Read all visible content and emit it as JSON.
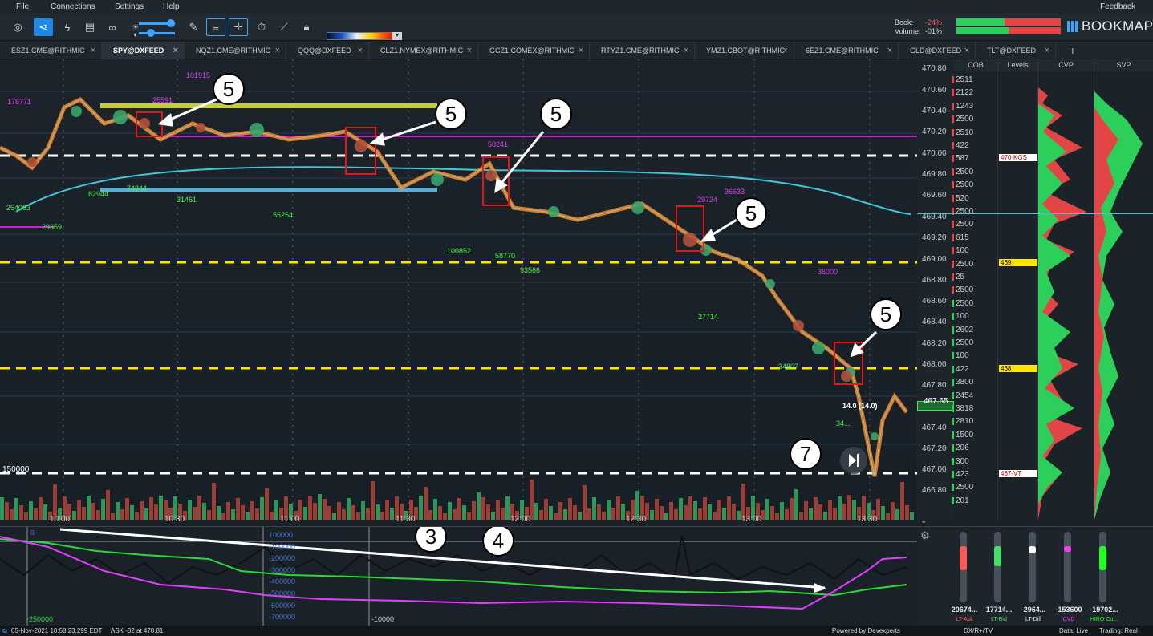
{
  "menu": {
    "items": [
      "File",
      "Connections",
      "Settings",
      "Help"
    ],
    "feedback": "Feedback"
  },
  "toolbar": {
    "book_label": "Book:",
    "book_value": "-24%",
    "volume_label": "Volume:",
    "volume_value": "-01%",
    "logo": "BOOKMAP"
  },
  "tabs": [
    {
      "label": "ESZ1.CME@RITHMIC"
    },
    {
      "label": "SPY@DXFEED",
      "active": true
    },
    {
      "label": "NQZ1.CME@RITHMIC"
    },
    {
      "label": "QQQ@DXFEED"
    },
    {
      "label": "CLZ1.NYMEX@RITHMIC"
    },
    {
      "label": "GCZ1.COMEX@RITHMIC"
    },
    {
      "label": "RTYZ1.CME@RITHMIC"
    },
    {
      "label": "YMZ1.CBOT@RITHMIC"
    },
    {
      "label": "6EZ1.CME@RITHMIC"
    },
    {
      "label": "GLD@DXFEED"
    },
    {
      "label": "TLT@DXFEED"
    }
  ],
  "columns": {
    "cob": "COB",
    "levels": "Levels",
    "cvp": "CVP",
    "svp": "SVP"
  },
  "price_axis": [
    "470.80",
    "470.60",
    "470.40",
    "470.20",
    "470.00",
    "469.80",
    "469.60",
    "469.40",
    "469.20",
    "469.00",
    "468.80",
    "468.60",
    "468.40",
    "468.20",
    "468.00",
    "467.80",
    "467.65",
    "467.40",
    "467.20",
    "467.00",
    "466.80"
  ],
  "cob_values": [
    "2511",
    "2122",
    "1243",
    "2500",
    "2510",
    "422",
    "587",
    "2500",
    "2500",
    "520",
    "2500",
    "2500",
    "615",
    "100",
    "2500",
    "25",
    "2500",
    "2500",
    "100",
    "2602",
    "2500",
    "100",
    "422",
    "3800",
    "2454",
    "3818",
    "2810",
    "1500",
    "206",
    "300",
    "423",
    "2500",
    "201"
  ],
  "level_tags": [
    "470-KGS",
    "469",
    "468",
    "467-VT"
  ],
  "time_labels": [
    "10:00",
    "10:30",
    "11:00",
    "11:30",
    "12:00",
    "12:30",
    "13:00",
    "13:30"
  ],
  "chart_labels": {
    "volume_scale": "150000",
    "level_numbers": [
      "178771",
      "101915",
      "25591",
      "82944",
      "74844",
      "31461",
      "254063",
      "29359",
      "55254",
      "58241",
      "100852",
      "58770",
      "93566",
      "29724",
      "36633",
      "27714",
      "36000",
      "34807",
      "34..."
    ],
    "last_trade": "14.0 (14.0)"
  },
  "annotations": {
    "five": "5",
    "three": "3",
    "four": "4",
    "seven": "7"
  },
  "indicator": {
    "scale": [
      "100000",
      "-100000",
      "-200000",
      "-300000",
      "-400000",
      "-500000",
      "-600000",
      "-700000"
    ],
    "left_value": "-250000",
    "mid_value": "-10000",
    "tick_left": "0"
  },
  "widgets": [
    {
      "value": "20674...",
      "name": "LT-Ask",
      "color": "#ff5a5a",
      "level": 0.34
    },
    {
      "value": "17714...",
      "name": "LT-Bid",
      "color": "#44e06a",
      "level": 0.28
    },
    {
      "value": "-2964...",
      "name": "LT-Diff",
      "color": "#ffffff",
      "level": 0.1
    },
    {
      "value": "-153600",
      "name": "CVD",
      "color": "#ff38ff",
      "level": 0.08
    },
    {
      "value": "-19702...",
      "name": "HIRO Cu...",
      "color": "#22ff22",
      "level": 0.34
    }
  ],
  "statusbar": {
    "datetime": "05-Nov-2021 10:58:23.299 EDT",
    "ask": "ASK -32 at 470.81",
    "powered": "Powered by Devexperts",
    "feed": "DX/R+/TV",
    "data": "Data: Live",
    "trading": "Trading: Real"
  }
}
